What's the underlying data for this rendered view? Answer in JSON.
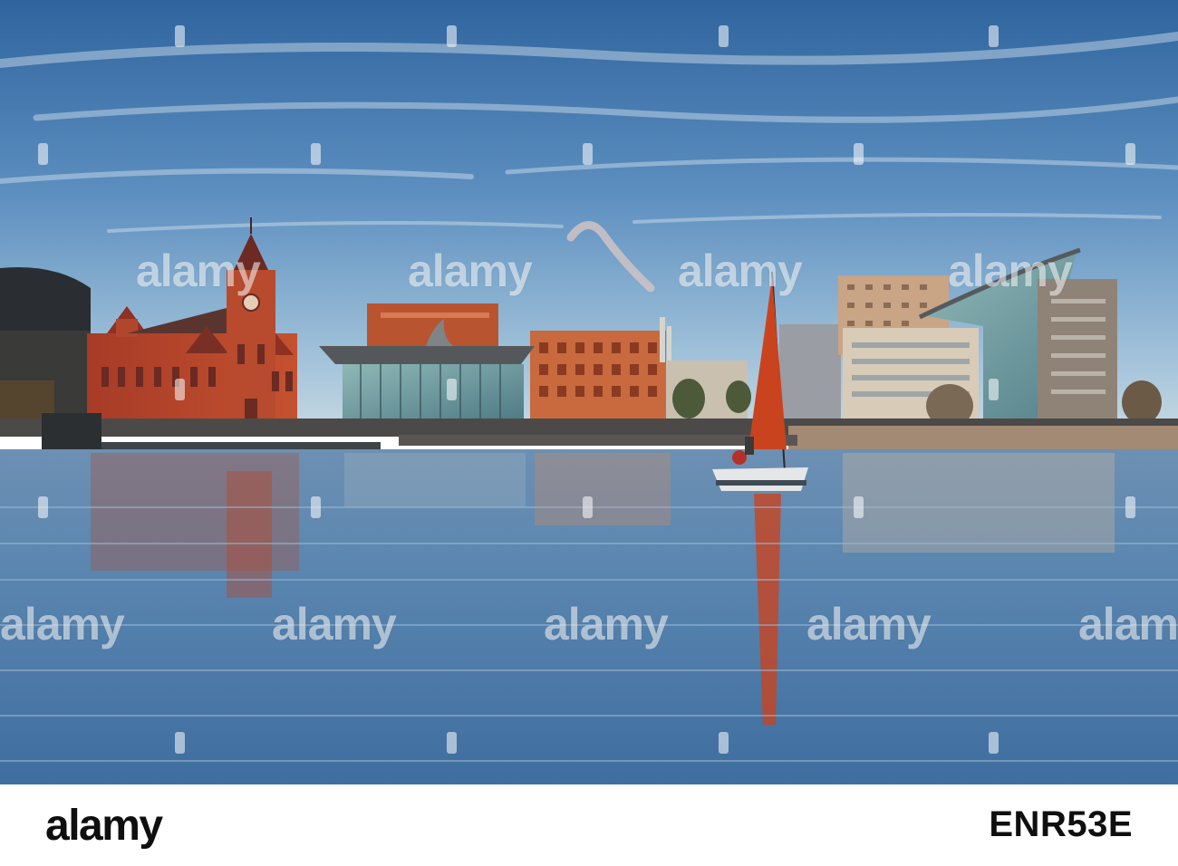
{
  "watermark": {
    "text": "alamy"
  },
  "footer": {
    "logo_text": "alamy",
    "image_id": "ENR53E"
  },
  "colors": {
    "sky_top": "#3a6fa8",
    "sky_horizon": "#bcd3e2",
    "water": "#5d84ab",
    "pierhead_brick": "#b8422c",
    "sail": "#c9431f",
    "footer_bg": "#ffffff",
    "footer_text": "#0f0f0f"
  }
}
